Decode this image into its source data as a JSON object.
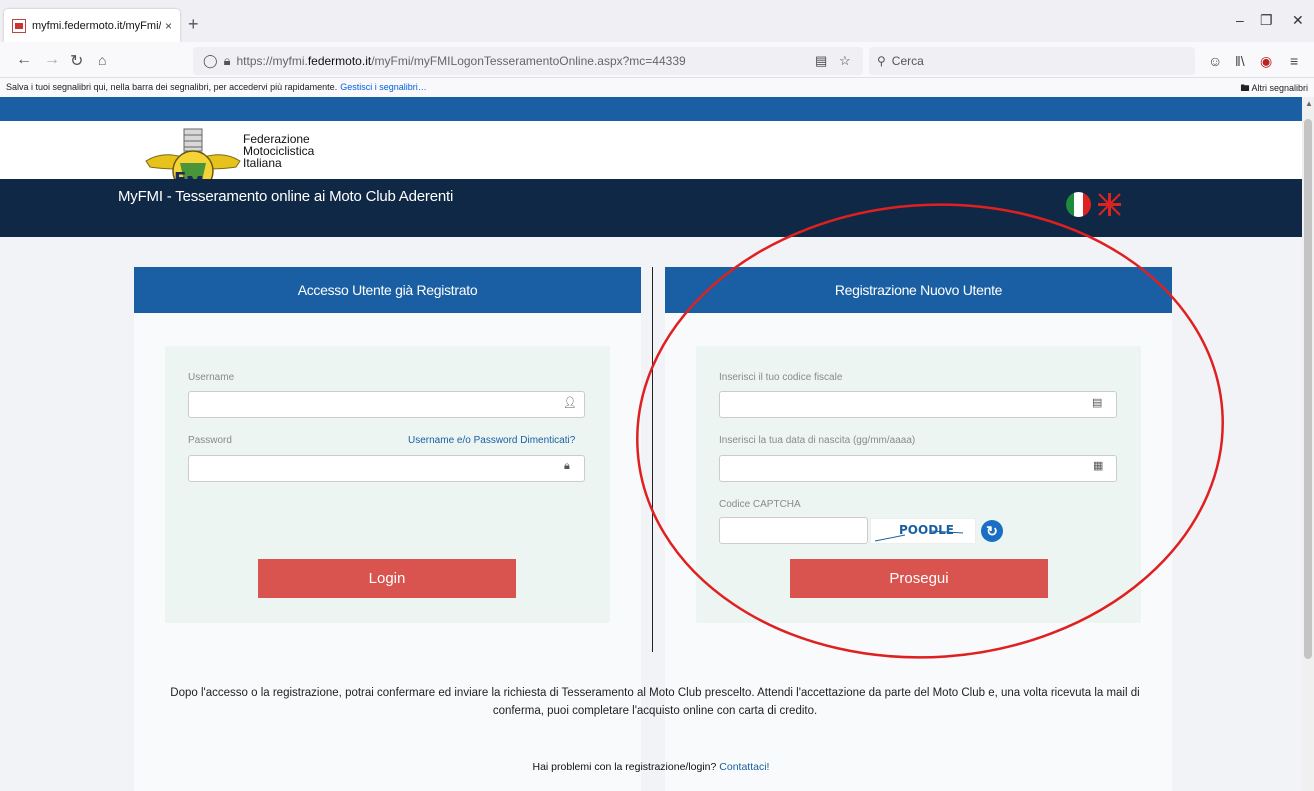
{
  "browser": {
    "tab_title": "myfmi.federmoto.it/myFmi/my",
    "tab_close": "×",
    "new_tab": "+",
    "url_prefix": "https://myfmi.",
    "url_host": "federmoto.it",
    "url_path": "/myFmi/myFMILogonTesseramentoOnline.aspx?mc=44339",
    "search_placeholder": "Cerca",
    "bookmark_bar_text": "Salva i tuoi segnalibri qui, nella barra dei segnalibri, per accedervi più rapidamente.",
    "bookmark_bar_link": "Gestisci i segnalibri…",
    "other_bookmarks": "Altri segnalibri",
    "icons": [
      "back-icon",
      "forward-icon",
      "reload-icon",
      "home-icon",
      "shield-icon",
      "lock-icon",
      "reader-icon",
      "star-icon",
      "search-icon",
      "account-icon",
      "library-icon",
      "extension-icon",
      "menu-icon"
    ]
  },
  "header": {
    "logo_line1": "Federazione",
    "logo_line2": "Motociclistica",
    "logo_line3": "Italiana",
    "site_title": "MyFMI - Tesseramento online ai Moto Club Aderenti",
    "brand_blue": "#1a5fa3",
    "dark_band": "#0f2845"
  },
  "login": {
    "heading": "Accesso Utente già Registrato",
    "username_label": "Username",
    "username_value": "",
    "password_label": "Password",
    "password_value": "",
    "forgot_link": "Username e/o Password Dimenticati?",
    "login_button": "Login"
  },
  "register": {
    "heading": "Registrazione Nuovo Utente",
    "cf_label": "Inserisci il tuo codice fiscale",
    "cf_value": "",
    "dob_label": "Inserisci la tua data di nascita (gg/mm/aaaa)",
    "dob_value": "",
    "captcha_label": "Codice CAPTCHA",
    "captcha_value": "",
    "captcha_image_text": "POODLE",
    "continue_button": "Prosegui",
    "button_color": "#d9534f"
  },
  "footer": {
    "info": "Dopo l'accesso o la registrazione, potrai confermare ed inviare la richiesta di Tesseramento al Moto Club prescelto. Attendi l'accettazione da parte del Moto Club e, una volta ricevuta la mail di conferma, puoi completare l'acquisto online con carta di credito.",
    "help_text": "Hai problemi con la registrazione/login?",
    "help_link": "Contattaci!"
  },
  "annotation": {
    "color": "#e02020",
    "shape": "ellipse around registration panel"
  }
}
